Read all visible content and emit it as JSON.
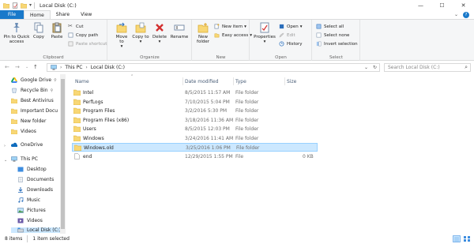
{
  "window": {
    "title": "Local Disk (C:)",
    "controls": [
      "—",
      "☐",
      "✕"
    ]
  },
  "ribbon_tabs": [
    "File",
    "Home",
    "Share",
    "View"
  ],
  "ribbon": {
    "clipboard": {
      "label": "Clipboard",
      "pin": "Pin to Quick access",
      "copy": "Copy",
      "paste": "Paste",
      "cut": "Cut",
      "copy_path": "Copy path",
      "paste_shortcut": "Paste shortcut"
    },
    "organize": {
      "label": "Organize",
      "move_to": "Move to",
      "copy_to": "Copy to",
      "delete": "Delete",
      "rename": "Rename"
    },
    "new": {
      "label": "New",
      "new_folder": "New folder",
      "new_item": "New item",
      "easy_access": "Easy access"
    },
    "open": {
      "label": "Open",
      "properties": "Properties",
      "open": "Open",
      "edit": "Edit",
      "history": "History"
    },
    "select": {
      "label": "Select",
      "select_all": "Select all",
      "select_none": "Select none",
      "invert": "Invert selection"
    }
  },
  "address": {
    "crumbs": [
      "This PC",
      "Local Disk (C:)"
    ],
    "search_placeholder": "Search Local Disk (C:)"
  },
  "nav_pane": {
    "items": [
      {
        "label": "Google Drive",
        "pinned": true
      },
      {
        "label": "Recycle Bin",
        "pinned": true
      },
      {
        "label": "Best Antivirus",
        "pinned": false
      },
      {
        "label": "Important Docu",
        "pinned": false
      },
      {
        "label": "New folder",
        "pinned": false
      },
      {
        "label": "Videos",
        "pinned": false
      },
      {
        "label": "OneDrive",
        "pinned": false
      },
      {
        "label": "This PC",
        "pinned": false
      },
      {
        "label": "Desktop",
        "pinned": false
      },
      {
        "label": "Documents",
        "pinned": false
      },
      {
        "label": "Downloads",
        "pinned": false
      },
      {
        "label": "Music",
        "pinned": false
      },
      {
        "label": "Pictures",
        "pinned": false
      },
      {
        "label": "Videos",
        "pinned": false
      },
      {
        "label": "Local Disk (C:)",
        "pinned": false
      }
    ],
    "pin_glyph": "📌"
  },
  "columns": {
    "name": "Name",
    "date": "Date modified",
    "type": "Type",
    "size": "Size"
  },
  "files": [
    {
      "name": "Intel",
      "date": "8/5/2015 11:57 AM",
      "type": "File folder",
      "size": "",
      "kind": "folder"
    },
    {
      "name": "PerfLogs",
      "date": "7/10/2015 5:04 PM",
      "type": "File folder",
      "size": "",
      "kind": "folder"
    },
    {
      "name": "Program Files",
      "date": "3/2/2016 5:30 PM",
      "type": "File folder",
      "size": "",
      "kind": "folder"
    },
    {
      "name": "Program Files (x86)",
      "date": "3/18/2016 11:36 AM",
      "type": "File folder",
      "size": "",
      "kind": "folder"
    },
    {
      "name": "Users",
      "date": "8/5/2015 12:03 PM",
      "type": "File folder",
      "size": "",
      "kind": "folder"
    },
    {
      "name": "Windows",
      "date": "3/24/2016 11:41 AM",
      "type": "File folder",
      "size": "",
      "kind": "folder"
    },
    {
      "name": "Windows.old",
      "date": "3/25/2016 1:06 PM",
      "type": "File folder",
      "size": "",
      "kind": "folder",
      "selected": true
    },
    {
      "name": "end",
      "date": "12/29/2015 1:55 PM",
      "type": "File",
      "size": "0 KB",
      "kind": "file"
    }
  ],
  "status": {
    "items": "8 items",
    "selected": "1 item selected"
  },
  "colors": {
    "file_tab": "#1979ca",
    "selection": "#cce8ff",
    "folder": "#f8d775",
    "ribbon_bg": "#f5f6f7"
  }
}
